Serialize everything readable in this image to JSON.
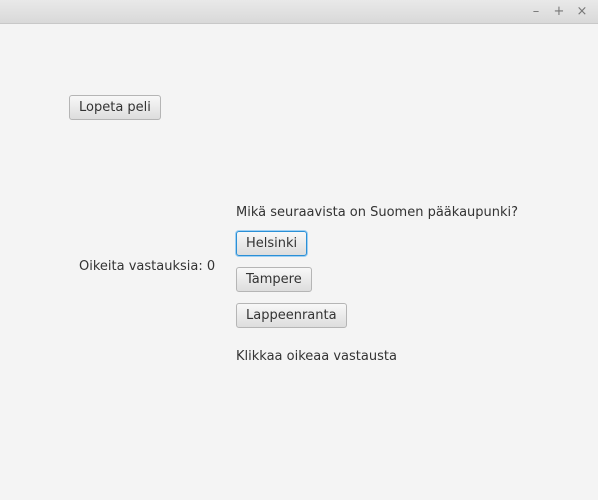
{
  "window": {
    "controls": {
      "minimize": "–",
      "maximize": "+",
      "close": "×"
    }
  },
  "toolbar": {
    "quit_label": "Lopeta peli"
  },
  "score": {
    "text": "Oikeita vastauksia: 0"
  },
  "question": {
    "text": "Mikä seuraavista on Suomen pääkaupunki?",
    "options": [
      "Helsinki",
      "Tampere",
      "Lappeenranta"
    ],
    "focused_option": "Helsinki"
  },
  "status": {
    "text": "Klikkaa oikeaa vastausta"
  },
  "colors": {
    "background": "#f4f4f4",
    "focus_ring": "#2a8fd6"
  }
}
